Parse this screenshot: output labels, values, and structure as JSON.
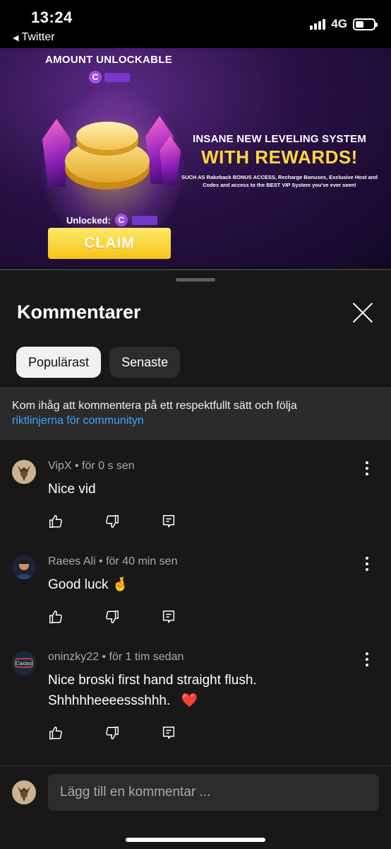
{
  "status_bar": {
    "time": "13:24",
    "back_app": "Twitter",
    "network": "4G",
    "battery_level": 0.45
  },
  "video": {
    "amount_label": "AMOUNT UNLOCKABLE",
    "unlocked_label": "Unlocked:",
    "coin_symbol": "C",
    "headline_1": "INSANE NEW LEVELING SYSTEM",
    "headline_2": "WITH REWARDS!",
    "subtext": "SUCH AS Rakeback BONUS ACCESS, Recharge Bonuses, Exclusive Host and Codes and access to the BEST VIP System you've ever seen!",
    "claim_label": "CLAIM"
  },
  "comments_panel": {
    "title": "Kommentarer",
    "tabs": [
      {
        "label": "Populärast",
        "active": true
      },
      {
        "label": "Senaste",
        "active": false
      }
    ],
    "notice_text": "Kom ihåg att kommentera på ett respektfullt sätt och följa",
    "notice_link": "riktlinjerna för communityn",
    "comments": [
      {
        "author": "VipX",
        "time": "för 0 s sen",
        "meta": "VipX • för 0 s sen",
        "text": "Nice vid",
        "emoji": ""
      },
      {
        "author": "Raees Ali",
        "time": "för 40 min sen",
        "meta": "Raees Ali • för 40 min sen",
        "text": "Good luck",
        "emoji": "🤞"
      },
      {
        "author": "oninzky22",
        "time": "för 1 tim sedan",
        "meta": "oninzky22 • för 1 tim sedan",
        "text": "Nice broski first hand straight flush. Shhhhheeeessshhh.",
        "emoji": "❤️"
      }
    ],
    "add_comment_placeholder": "Lägg till en kommentar ..."
  },
  "icons": [
    "thumbs-up-icon",
    "thumbs-down-icon",
    "reply-icon",
    "more-vert-icon",
    "close-icon"
  ],
  "colors": {
    "link": "#3ea6ff",
    "sheet_bg": "#181818",
    "claim_yellow": "#f5c518",
    "headline_yellow": "#ffd83a"
  }
}
